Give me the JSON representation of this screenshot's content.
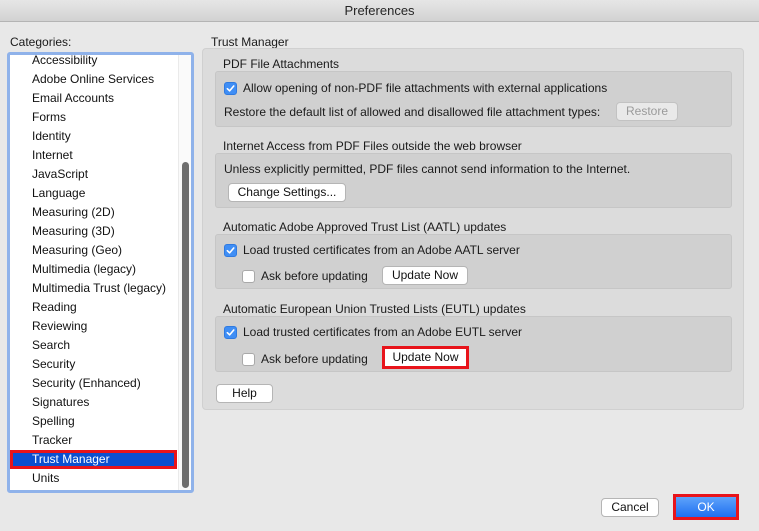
{
  "window": {
    "title": "Preferences"
  },
  "sidebar": {
    "label": "Categories:",
    "items": [
      {
        "label": "Accessibility"
      },
      {
        "label": "Adobe Online Services"
      },
      {
        "label": "Email Accounts"
      },
      {
        "label": "Forms"
      },
      {
        "label": "Identity"
      },
      {
        "label": "Internet"
      },
      {
        "label": "JavaScript"
      },
      {
        "label": "Language"
      },
      {
        "label": "Measuring (2D)"
      },
      {
        "label": "Measuring (3D)"
      },
      {
        "label": "Measuring (Geo)"
      },
      {
        "label": "Multimedia (legacy)"
      },
      {
        "label": "Multimedia Trust (legacy)"
      },
      {
        "label": "Reading"
      },
      {
        "label": "Reviewing"
      },
      {
        "label": "Search"
      },
      {
        "label": "Security"
      },
      {
        "label": "Security (Enhanced)"
      },
      {
        "label": "Signatures"
      },
      {
        "label": "Spelling"
      },
      {
        "label": "Tracker"
      },
      {
        "label": "Trust Manager",
        "selected": true
      },
      {
        "label": "Units"
      }
    ],
    "selected": "Trust Manager"
  },
  "main": {
    "title": "Trust Manager",
    "pdf_attachments": {
      "title": "PDF File Attachments",
      "allow_checkbox": {
        "label": "Allow opening of non-PDF file attachments with external applications",
        "checked": true
      },
      "restore_text": "Restore the default list of allowed and disallowed file attachment types:",
      "restore_button": {
        "label": "Restore",
        "enabled": false
      }
    },
    "internet_access": {
      "title": "Internet Access from PDF Files outside the web browser",
      "description": "Unless explicitly permitted, PDF files cannot send information to the Internet.",
      "change_settings_button": "Change Settings..."
    },
    "aatl": {
      "title": "Automatic Adobe Approved Trust List (AATL) updates",
      "load_checkbox": {
        "label": "Load trusted certificates from an Adobe AATL server",
        "checked": true
      },
      "ask_checkbox": {
        "label": "Ask before updating",
        "checked": false
      },
      "update_button": "Update Now"
    },
    "eutl": {
      "title": "Automatic European Union Trusted Lists (EUTL) updates",
      "load_checkbox": {
        "label": "Load trusted certificates from an Adobe EUTL server",
        "checked": true
      },
      "ask_checkbox": {
        "label": "Ask before updating",
        "checked": false
      },
      "update_button": "Update Now"
    },
    "help_button": "Help"
  },
  "footer": {
    "cancel_button": "Cancel",
    "ok_button": "OK"
  },
  "colors": {
    "selection": "#0b4fd0",
    "highlight_outline": "#e8141b",
    "checkbox_checked": "#3f8ef5",
    "ok_button": "#1f6ff0"
  }
}
